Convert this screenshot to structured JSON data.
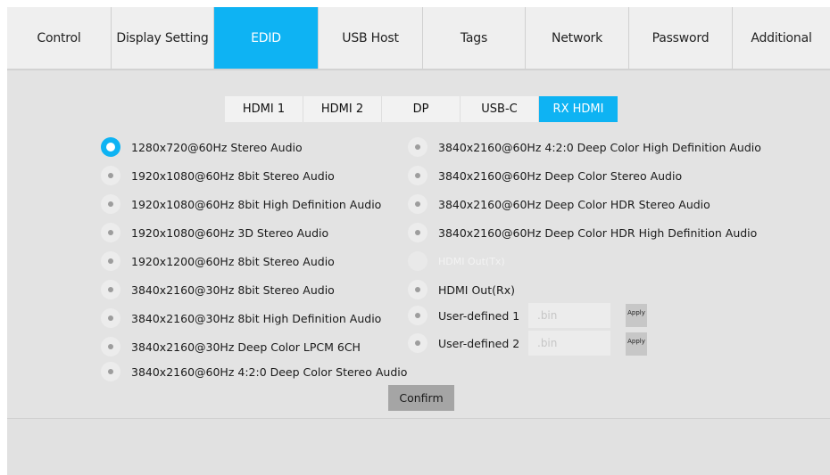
{
  "topnav": {
    "tabs": [
      {
        "label": "Control",
        "width": 117
      },
      {
        "label": "Display Setting",
        "width": 115
      },
      {
        "label": "EDID",
        "width": 117,
        "active": true
      },
      {
        "label": "USB Host",
        "width": 117
      },
      {
        "label": "Tags",
        "width": 115
      },
      {
        "label": "Network",
        "width": 116
      },
      {
        "label": "Password",
        "width": 116
      },
      {
        "label": "Additional",
        "width": 109
      }
    ]
  },
  "edid": {
    "subtabs": [
      "HDMI 1",
      "HDMI 2",
      "DP",
      "USB-C",
      "RX HDMI"
    ],
    "active_subtab": "RX HDMI",
    "left_options": [
      "1280x720@60Hz Stereo Audio",
      "1920x1080@60Hz 8bit Stereo Audio",
      "1920x1080@60Hz 8bit High Definition Audio",
      "1920x1080@60Hz 3D Stereo Audio",
      "1920x1200@60Hz 8bit Stereo Audio",
      "3840x2160@30Hz 8bit Stereo Audio",
      "3840x2160@30Hz 8bit High Definition Audio",
      "3840x2160@30Hz Deep Color LPCM 6CH",
      "3840x2160@60Hz 4:2:0 Deep Color Stereo Audio"
    ],
    "right_options": [
      "3840x2160@60Hz 4:2:0 Deep Color High Definition Audio",
      "3840x2160@60Hz Deep Color Stereo Audio",
      "3840x2160@60Hz Deep Color HDR Stereo Audio",
      "3840x2160@60Hz Deep Color HDR High Definition Audio",
      "HDMI Out(Tx)",
      "HDMI Out(Rx)"
    ],
    "selected_option": "1280x720@60Hz Stereo Audio",
    "disabled_option": "HDMI Out(Tx)",
    "user_defined": [
      {
        "label": "User-defined 1",
        "placeholder": ".bin",
        "apply_label": "Apply"
      },
      {
        "label": "User-defined 2",
        "placeholder": ".bin",
        "apply_label": "Apply"
      }
    ],
    "confirm_label": "Confirm"
  },
  "colors": {
    "accent": "#0eb3f3",
    "background": "#e1e1e1",
    "nav_background": "#efefef",
    "confirm_button": "#a5a5a5"
  }
}
